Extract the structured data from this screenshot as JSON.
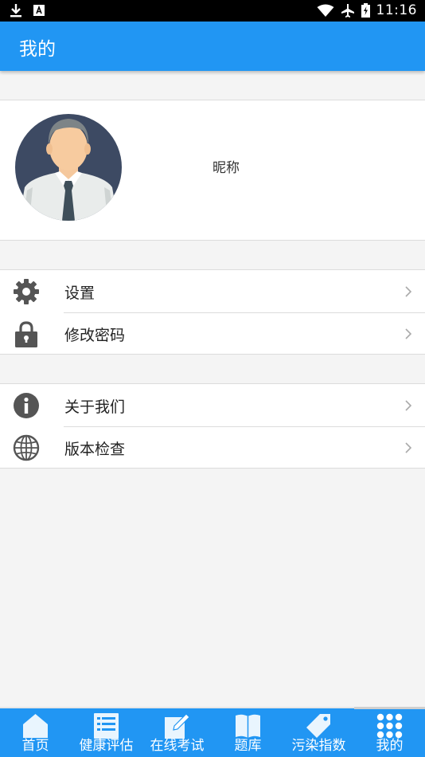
{
  "status_bar": {
    "time": "11:16"
  },
  "header": {
    "title": "我的"
  },
  "profile": {
    "nickname": "昵称"
  },
  "menu_group_1": [
    {
      "label": "设置",
      "icon": "gear-icon"
    },
    {
      "label": "修改密码",
      "icon": "lock-icon"
    }
  ],
  "menu_group_2": [
    {
      "label": "关于我们",
      "icon": "info-icon"
    },
    {
      "label": "版本检查",
      "icon": "globe-icon"
    }
  ],
  "bottom_nav": {
    "tabs": [
      {
        "label": "首页",
        "icon": "home-icon"
      },
      {
        "label": "健康评估",
        "icon": "list-icon"
      },
      {
        "label": "在线考试",
        "icon": "edit-icon"
      },
      {
        "label": "题库",
        "icon": "book-icon"
      },
      {
        "label": "污染指数",
        "icon": "tag-icon"
      },
      {
        "label": "我的",
        "icon": "grid-icon"
      }
    ],
    "active_index": 5
  },
  "colors": {
    "primary": "#2196f3",
    "divider": "#dcdcdc",
    "icon_gray": "#555555"
  }
}
